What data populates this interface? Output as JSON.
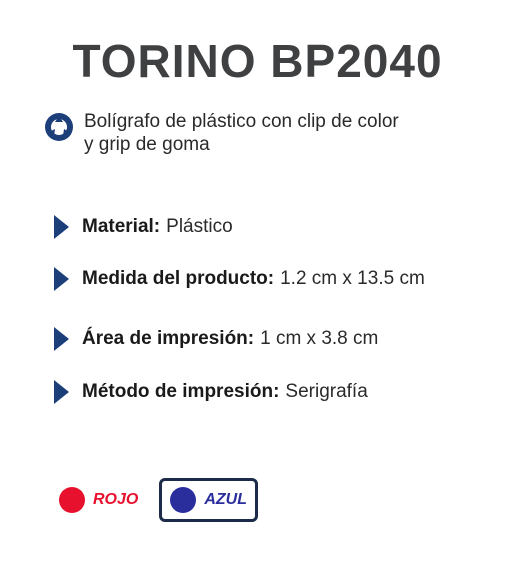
{
  "product": {
    "title": "TORINO BP2040",
    "description_line1": "Bolígrafo de plástico con clip de color",
    "description_line2": "y grip de goma",
    "description_icon": "recycle-icon"
  },
  "specs": [
    {
      "label": "Material:",
      "value": "Plástico"
    },
    {
      "label": "Medida del producto:",
      "value": "1.2 cm x 13.5 cm"
    },
    {
      "label": "Área de impresión:",
      "value": "1 cm x 3.8 cm"
    },
    {
      "label": "Método de impresión:",
      "value": "Serigrafía"
    }
  ],
  "colors": [
    {
      "name": "ROJO",
      "hex": "#e8112d",
      "selected": false
    },
    {
      "name": "AZUL",
      "hex": "#2a2e9c",
      "selected": true
    }
  ],
  "theme": {
    "title_color": "#3f4042",
    "accent": "#1c3f7a",
    "selected_border": "#1c2b4a"
  }
}
